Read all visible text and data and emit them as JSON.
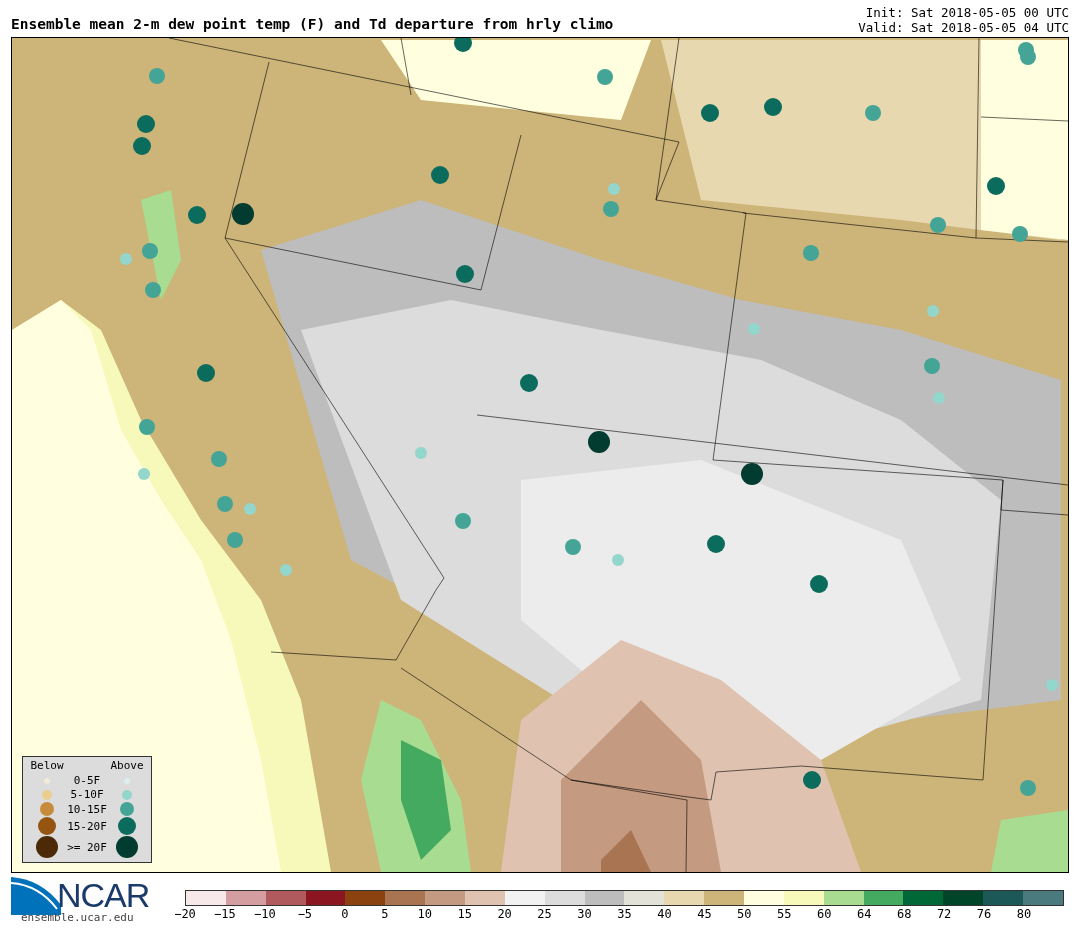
{
  "title": "Ensemble mean 2-m dew point temp (F) and Td departure from hrly climo",
  "times": [
    "Init: Sat 2018-05-05 00 UTC",
    "Valid: Sat 2018-05-05 04 UTC"
  ],
  "legend": {
    "headers": [
      "Below",
      "Above"
    ],
    "rows": [
      {
        "label": "0-5F",
        "below": {
          "color": "#f5ead8"
        },
        "above": {
          "color": "#dcefee"
        }
      },
      {
        "label": "5-10F",
        "below": {
          "color": "#e8cf8e"
        },
        "above": {
          "color": "#93d6cb"
        }
      },
      {
        "label": "10-15F",
        "below": {
          "color": "#c68c3c"
        },
        "above": {
          "color": "#44a596"
        }
      },
      {
        "label": "15-20F",
        "below": {
          "color": "#955410"
        },
        "above": {
          "color": "#0b6b5d"
        }
      },
      {
        "label": ">= 20F",
        "below": {
          "color": "#4c2a08"
        },
        "above": {
          "color": "#023b30"
        }
      }
    ]
  },
  "logo": {
    "name": "NCAR",
    "site": "ensemble.ucar.edu"
  },
  "colorbar": {
    "bins": [
      {
        "color": "#f7e8ea"
      },
      {
        "color": "#d49ea0"
      },
      {
        "color": "#b05a5e"
      },
      {
        "color": "#8b1520"
      },
      {
        "color": "#8b420f"
      },
      {
        "color": "#a87452"
      },
      {
        "color": "#c49a80"
      },
      {
        "color": "#dfc3b0"
      },
      {
        "color": "#f2f2f2"
      },
      {
        "color": "#dcdcdc"
      },
      {
        "color": "#bdbdbd"
      },
      {
        "color": "#e2e2d8"
      },
      {
        "color": "#e8d8b0"
      },
      {
        "color": "#cdb478"
      },
      {
        "color": "#ffffe0"
      },
      {
        "color": "#f7f9bb"
      },
      {
        "color": "#a8dc90"
      },
      {
        "color": "#44aa60"
      },
      {
        "color": "#006837"
      },
      {
        "color": "#00442a"
      },
      {
        "color": "#1d5858"
      },
      {
        "color": "#4a7a7e"
      }
    ],
    "ticks": [
      "−20",
      "−15",
      "−10",
      "−5",
      "0",
      "5",
      "10",
      "15",
      "20",
      "25",
      "30",
      "35",
      "40",
      "45",
      "50",
      "55",
      "60",
      "64",
      "68",
      "72",
      "76",
      "80"
    ]
  }
}
